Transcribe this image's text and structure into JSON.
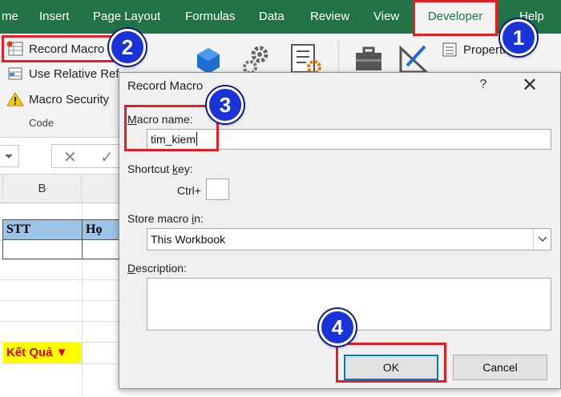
{
  "ribbon_tabs": [
    "me",
    "Insert",
    "Page Layout",
    "Formulas",
    "Data",
    "Review",
    "View",
    "Developer",
    "Help"
  ],
  "ribbon": {
    "record_macro": "Record Macro",
    "use_relative": "Use Relative Ref",
    "macro_security": "Macro Security",
    "group_label": "Code",
    "properties": "Propertie"
  },
  "formula_bar": {
    "ctrl_x": "✕",
    "ctrl_check": "✓"
  },
  "grid": {
    "column_b": "B",
    "header_stt": "STT",
    "header_ho": "Họ",
    "result_label": "Kết Quả ▼"
  },
  "dialog": {
    "title": "Record Macro",
    "help": "?",
    "close": "✕",
    "macro_name_label_ul": "M",
    "macro_name_label_rest": "acro name:",
    "macro_name_value": "tim_kiem",
    "shortcut_label_pre": "Shortcut ",
    "shortcut_label_ul": "k",
    "shortcut_label_post": "ey:",
    "ctrl_label": "Ctrl+",
    "shortcut_value": "",
    "store_label_pre": "Store macro ",
    "store_label_ul": "i",
    "store_label_post": "n:",
    "store_value": "This Workbook",
    "description_label_ul": "D",
    "description_label_rest": "escription:",
    "description_value": "",
    "ok": "OK",
    "cancel": "Cancel"
  },
  "annotations": [
    "1",
    "2",
    "3",
    "4"
  ],
  "colors": {
    "excel_green": "#217346",
    "annotation_red": "#e31e24",
    "badge_blue": "#1a33d8",
    "header_fill": "#9dc3e6",
    "result_fill": "#ffff00"
  }
}
